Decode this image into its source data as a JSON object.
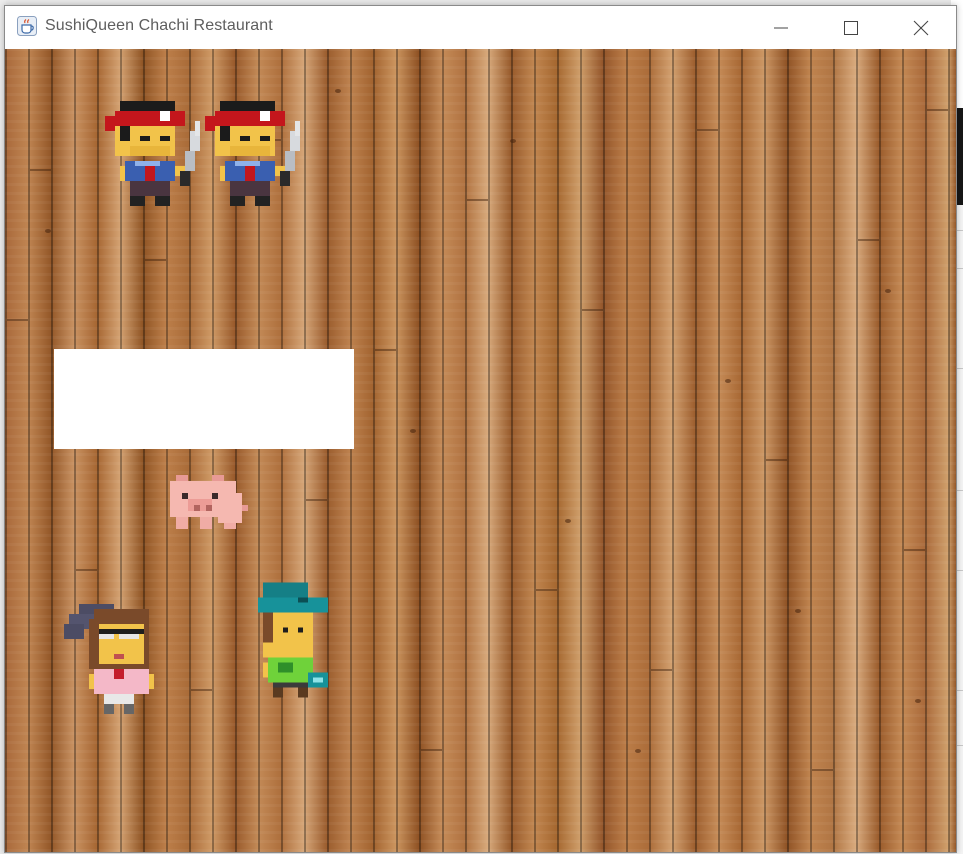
{
  "window": {
    "title": "SushiQueen Chachi Restaurant",
    "icon": "java-cup-icon",
    "controls": {
      "minimize_icon": "minimize-icon",
      "maximize_icon": "maximize-icon",
      "close_icon": "close-icon"
    }
  },
  "game": {
    "background": "wooden-plank-floor",
    "message_box": {
      "text": ""
    },
    "sprites": [
      {
        "name": "chef",
        "icon": "chef-with-knife-icon"
      },
      {
        "name": "chef",
        "icon": "chef-with-knife-icon"
      },
      {
        "name": "pig",
        "icon": "pig-icon"
      },
      {
        "name": "customer-girl",
        "icon": "customer-girl-icon"
      },
      {
        "name": "customer-boy",
        "icon": "customer-boy-icon"
      }
    ]
  },
  "colors": {
    "chef_headband": "#c4161c",
    "chef_shirt": "#3a5fb0",
    "skin": "#f2c34a",
    "pig": "#f5b8b0",
    "cap": "#157f86",
    "green_shirt": "#6fd23a"
  }
}
